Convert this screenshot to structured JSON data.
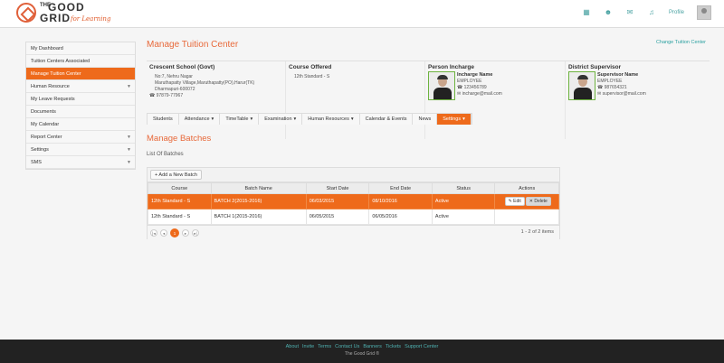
{
  "brand": {
    "the": "THE",
    "good": "GOOD",
    "grid": "GRID",
    "tagline": "for Learning"
  },
  "topnav": {
    "profile_label": "Profile"
  },
  "sidebar": {
    "items": [
      {
        "label": "My Dashboard",
        "active": false,
        "caret": ""
      },
      {
        "label": "Tuition Centers Associated",
        "active": false,
        "caret": ""
      },
      {
        "label": "Manage Tuition Center",
        "active": true,
        "caret": ""
      },
      {
        "label": "Human Resource",
        "active": false,
        "caret": "▼"
      },
      {
        "label": "My Leave Requests",
        "active": false,
        "caret": ""
      },
      {
        "label": "Documents",
        "active": false,
        "caret": ""
      },
      {
        "label": "My Calendar",
        "active": false,
        "caret": ""
      },
      {
        "label": "Report Center",
        "active": false,
        "caret": "▼"
      },
      {
        "label": "Settings",
        "active": false,
        "caret": "▼"
      },
      {
        "label": "SMS",
        "active": false,
        "caret": "▼"
      }
    ]
  },
  "page": {
    "title": "Manage Tuition Center",
    "change_link": "Change Tuition Center"
  },
  "center": {
    "heading": "Crescent School (Govt)",
    "address1": "No:7, Nehru Nagar",
    "address2": "Maruthapatty Village,Maruthapatty(PO),Harur(TK)",
    "address3": "Dharmapuri-600072",
    "phone": "97879-77967"
  },
  "course": {
    "heading": "Course Offered",
    "value": "12th Standard - S"
  },
  "incharge": {
    "heading": "Person Incharge",
    "name": "Incharge Name",
    "role": "EMPLOYEE",
    "phone": "123456789",
    "email": "incharge@mail.com"
  },
  "supervisor": {
    "heading": "District Supervisor",
    "name": "Supervisor Name",
    "role": "EMPLOYEE",
    "phone": "987654321",
    "email": "supervisor@mail.com"
  },
  "tabs": [
    {
      "label": "Students",
      "caret": "",
      "active": false
    },
    {
      "label": "Attendance",
      "caret": "▾",
      "active": false
    },
    {
      "label": "TimeTable",
      "caret": "▾",
      "active": false
    },
    {
      "label": "Examination",
      "caret": "▾",
      "active": false
    },
    {
      "label": "Human Resources",
      "caret": "▾",
      "active": false
    },
    {
      "label": "Calendar & Events",
      "caret": "",
      "active": false
    },
    {
      "label": "News",
      "caret": "",
      "active": false
    },
    {
      "label": "Settings",
      "caret": "▾",
      "active": true
    }
  ],
  "batches": {
    "section_title": "Manage Batches",
    "list_title": "List Of Batches",
    "add_button": "+ Add a New Batch",
    "columns": [
      "Course",
      "Batch Name",
      "Start Date",
      "End Date",
      "Status",
      "Actions"
    ],
    "rows": [
      {
        "course": "12th Standard - S",
        "batch": "BATCH 2(2015-2016)",
        "start": "06/03/2015",
        "end": "08/10/2016",
        "status": "Active",
        "selected": true
      },
      {
        "course": "12th Standard - S",
        "batch": "BATCH 1(2015-2016)",
        "start": "06/05/2015",
        "end": "06/05/2016",
        "status": "Active",
        "selected": false
      }
    ],
    "edit_label": "✎ Edit",
    "delete_label": "✕ Delete",
    "current_page": "1",
    "pager_info": "1 - 2 of 2 items"
  },
  "footer": {
    "links": [
      "About",
      "Invite",
      "Terms",
      "Contact Us",
      "Banners",
      "Tickets",
      "Support Center"
    ],
    "copyright": "The Good Grid ®"
  }
}
